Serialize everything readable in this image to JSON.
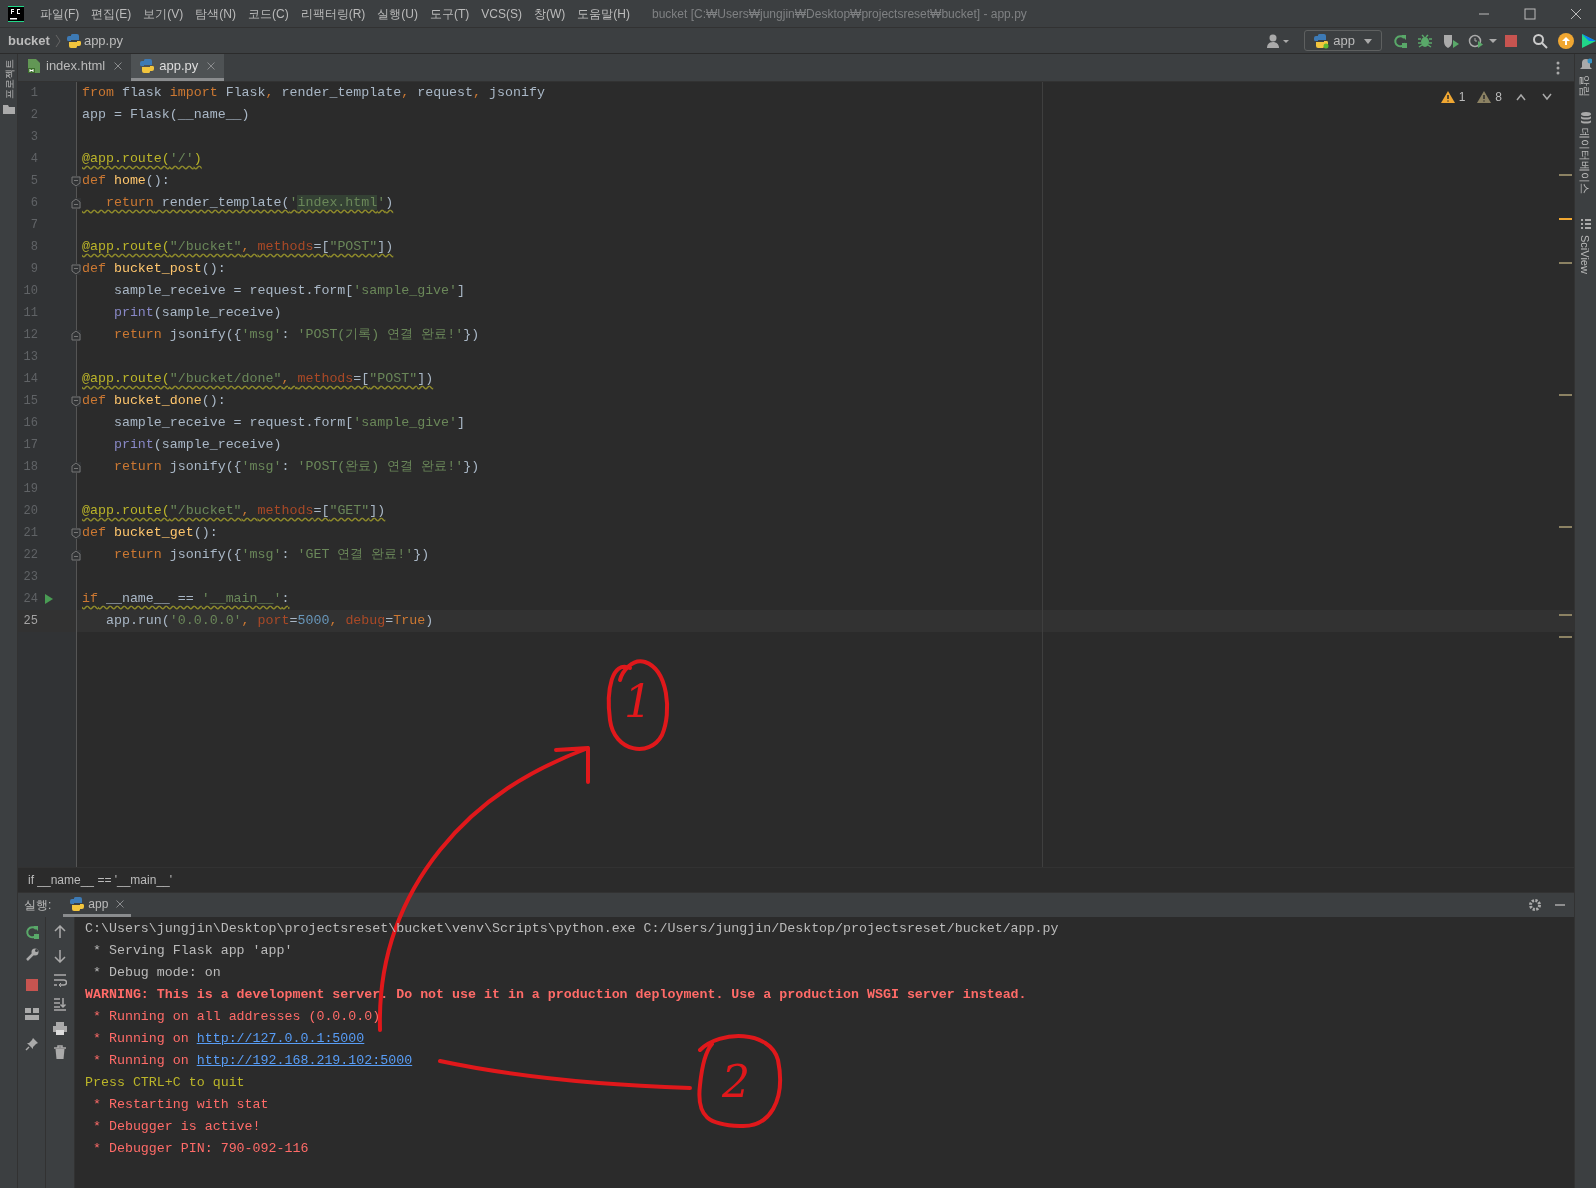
{
  "window": {
    "title": "bucket [C:₩Users₩jungjin₩Desktop₩projectsreset₩bucket] - app.py"
  },
  "menu": [
    "파일(F)",
    "편집(E)",
    "보기(V)",
    "탐색(N)",
    "코드(C)",
    "리팩터링(R)",
    "실행(U)",
    "도구(T)",
    "VCS(S)",
    "창(W)",
    "도움말(H)"
  ],
  "breadcrumbs": [
    "bucket",
    "app.py"
  ],
  "run_config": "app",
  "left_strip": [
    "프로젝트"
  ],
  "right_strip": [
    "알림",
    "데이터베이스",
    "SciView"
  ],
  "tabs": [
    {
      "label": "index.html",
      "kind": "html",
      "selected": false
    },
    {
      "label": "app.py",
      "kind": "python",
      "selected": true
    }
  ],
  "inspections": {
    "warnings": "1",
    "weak_warnings": "8"
  },
  "code_lines": [
    {
      "number": "1",
      "current": false,
      "squiggly": false,
      "tokens": [
        {
          "kind": "kw",
          "t": "from"
        },
        {
          "kind": "tx",
          "t": " flask "
        },
        {
          "kind": "kw",
          "t": "import"
        },
        {
          "kind": "tx",
          "t": " Flask"
        },
        {
          "kind": "kw",
          "t": ", "
        },
        {
          "kind": "tx",
          "t": "render_template"
        },
        {
          "kind": "kw",
          "t": ", "
        },
        {
          "kind": "tx",
          "t": "request"
        },
        {
          "kind": "kw",
          "t": ", "
        },
        {
          "kind": "tx",
          "t": "jsonify"
        }
      ]
    },
    {
      "number": "2",
      "current": false,
      "squiggly": false,
      "tokens": [
        {
          "kind": "tx",
          "t": "app = Flask(__name__)"
        }
      ]
    },
    {
      "number": "3",
      "current": false
    },
    {
      "number": "4",
      "current": false,
      "squiggly": true,
      "tokens": [
        {
          "kind": "dec",
          "t": "@app.route("
        },
        {
          "kind": "str",
          "t": "'/'"
        },
        {
          "kind": "dec",
          "t": ")"
        }
      ]
    },
    {
      "number": "5",
      "current": false,
      "squiggly": false,
      "fold_start": true,
      "tokens": [
        {
          "kind": "kw",
          "t": "def "
        },
        {
          "kind": "fn",
          "t": "home"
        },
        {
          "kind": "tx",
          "t": "():"
        }
      ]
    },
    {
      "number": "6",
      "current": false,
      "squiggly": true,
      "fold_end": true,
      "tokens": [
        {
          "kind": "kw",
          "t": "   return"
        },
        {
          "kind": "tx",
          "t": " render_template("
        },
        {
          "kind": "str",
          "t": "'"
        },
        {
          "kind": "hl",
          "t": "index.html"
        },
        {
          "kind": "str",
          "t": "'"
        },
        {
          "kind": "tx",
          "t": ")"
        }
      ]
    },
    {
      "number": "7",
      "current": false
    },
    {
      "number": "8",
      "current": false,
      "squiggly": true,
      "tokens": [
        {
          "kind": "dec",
          "t": "@app.route("
        },
        {
          "kind": "str",
          "t": "\"/bucket\""
        },
        {
          "kind": "kw",
          "t": ", "
        },
        {
          "kind": "par",
          "t": "methods"
        },
        {
          "kind": "tx",
          "t": "=["
        },
        {
          "kind": "str",
          "t": "\"POST\""
        },
        {
          "kind": "tx",
          "t": "])"
        }
      ]
    },
    {
      "number": "9",
      "current": false,
      "squiggly": false,
      "fold_start": true,
      "tokens": [
        {
          "kind": "kw",
          "t": "def "
        },
        {
          "kind": "fn",
          "t": "bucket_post"
        },
        {
          "kind": "tx",
          "t": "():"
        }
      ]
    },
    {
      "number": "10",
      "current": false,
      "squiggly": false,
      "tokens": [
        {
          "kind": "tx",
          "t": "    sample_receive = request.form["
        },
        {
          "kind": "str",
          "t": "'sample_give'"
        },
        {
          "kind": "tx",
          "t": "]"
        }
      ]
    },
    {
      "number": "11",
      "current": false,
      "squiggly": false,
      "tokens": [
        {
          "kind": "bi",
          "t": "    print"
        },
        {
          "kind": "tx",
          "t": "(sample_receive)"
        }
      ]
    },
    {
      "number": "12",
      "current": false,
      "squiggly": false,
      "fold_end": true,
      "tokens": [
        {
          "kind": "kw",
          "t": "    return"
        },
        {
          "kind": "tx",
          "t": " jsonify({"
        },
        {
          "kind": "str",
          "t": "'msg'"
        },
        {
          "kind": "tx",
          "t": ": "
        },
        {
          "kind": "str",
          "t": "'POST(기록) 연결 완료!'"
        },
        {
          "kind": "tx",
          "t": "})"
        }
      ]
    },
    {
      "number": "13",
      "current": false
    },
    {
      "number": "14",
      "current": false,
      "squiggly": true,
      "tokens": [
        {
          "kind": "dec",
          "t": "@app.route("
        },
        {
          "kind": "str",
          "t": "\"/bucket/done\""
        },
        {
          "kind": "kw",
          "t": ", "
        },
        {
          "kind": "par",
          "t": "methods"
        },
        {
          "kind": "tx",
          "t": "=["
        },
        {
          "kind": "str",
          "t": "\"POST\""
        },
        {
          "kind": "tx",
          "t": "])"
        }
      ]
    },
    {
      "number": "15",
      "current": false,
      "squiggly": false,
      "fold_start": true,
      "tokens": [
        {
          "kind": "kw",
          "t": "def "
        },
        {
          "kind": "fn",
          "t": "bucket_done"
        },
        {
          "kind": "tx",
          "t": "():"
        }
      ]
    },
    {
      "number": "16",
      "current": false,
      "squiggly": false,
      "tokens": [
        {
          "kind": "tx",
          "t": "    sample_receive = request.form["
        },
        {
          "kind": "str",
          "t": "'sample_give'"
        },
        {
          "kind": "tx",
          "t": "]"
        }
      ]
    },
    {
      "number": "17",
      "current": false,
      "squiggly": false,
      "tokens": [
        {
          "kind": "bi",
          "t": "    print"
        },
        {
          "kind": "tx",
          "t": "(sample_receive)"
        }
      ]
    },
    {
      "number": "18",
      "current": false,
      "squiggly": false,
      "fold_end": true,
      "tokens": [
        {
          "kind": "kw",
          "t": "    return"
        },
        {
          "kind": "tx",
          "t": " jsonify({"
        },
        {
          "kind": "str",
          "t": "'msg'"
        },
        {
          "kind": "tx",
          "t": ": "
        },
        {
          "kind": "str",
          "t": "'POST(완료) 연결 완료!'"
        },
        {
          "kind": "tx",
          "t": "})"
        }
      ]
    },
    {
      "number": "19",
      "current": false
    },
    {
      "number": "20",
      "current": false,
      "squiggly": true,
      "tokens": [
        {
          "kind": "dec",
          "t": "@app.route("
        },
        {
          "kind": "str",
          "t": "\"/bucket\""
        },
        {
          "kind": "kw",
          "t": ", "
        },
        {
          "kind": "par",
          "t": "methods"
        },
        {
          "kind": "tx",
          "t": "=["
        },
        {
          "kind": "str",
          "t": "\"GET\""
        },
        {
          "kind": "tx",
          "t": "])"
        }
      ]
    },
    {
      "number": "21",
      "current": false,
      "squiggly": false,
      "fold_start": true,
      "tokens": [
        {
          "kind": "kw",
          "t": "def "
        },
        {
          "kind": "fn",
          "t": "bucket_get"
        },
        {
          "kind": "tx",
          "t": "():"
        }
      ]
    },
    {
      "number": "22",
      "current": false,
      "squiggly": false,
      "fold_end": true,
      "tokens": [
        {
          "kind": "kw",
          "t": "    return"
        },
        {
          "kind": "tx",
          "t": " jsonify({"
        },
        {
          "kind": "str",
          "t": "'msg'"
        },
        {
          "kind": "tx",
          "t": ": "
        },
        {
          "kind": "str",
          "t": "'GET 연결 완료!'"
        },
        {
          "kind": "tx",
          "t": "})"
        }
      ]
    },
    {
      "number": "23",
      "current": false
    },
    {
      "number": "24",
      "current": false,
      "squiggly": true,
      "run": true,
      "tokens": [
        {
          "kind": "kw",
          "t": "if"
        },
        {
          "kind": "tx",
          "t": " __name__ == "
        },
        {
          "kind": "str",
          "t": "'__main__'"
        },
        {
          "kind": "tx",
          "t": ":"
        }
      ]
    },
    {
      "number": "25",
      "current": true,
      "squiggly": false,
      "tokens": [
        {
          "kind": "tx",
          "t": "   app.run("
        },
        {
          "kind": "str",
          "t": "'0.0.0.0'"
        },
        {
          "kind": "kw",
          "t": ", "
        },
        {
          "kind": "par",
          "t": "port"
        },
        {
          "kind": "tx",
          "t": "="
        },
        {
          "kind": "num",
          "t": "5000"
        },
        {
          "kind": "kw",
          "t": ", "
        },
        {
          "kind": "par",
          "t": "debug"
        },
        {
          "kind": "tx",
          "t": "="
        },
        {
          "kind": "kw",
          "t": "True"
        },
        {
          "kind": "tx",
          "t": ")"
        }
      ]
    }
  ],
  "editor_breadcrumb": "if __name__ == '__main__'",
  "run_panel": {
    "label": "실행:",
    "tab": {
      "label": "app",
      "selected": true
    }
  },
  "console_lines": [
    {
      "kind": "plain",
      "text": "C:\\Users\\jungjin\\Desktop\\projectsreset\\bucket\\venv\\Scripts\\python.exe C:/Users/jungjin/Desktop/projectsreset/bucket/app.py"
    },
    {
      "kind": "plain",
      "text": " * Serving Flask app 'app'"
    },
    {
      "kind": "plain",
      "text": " * Debug mode: on"
    },
    {
      "kind": "warning",
      "text": "WARNING: This is a development server. Do not use it in a production deployment. Use a production WSGI server instead."
    },
    {
      "kind": "error",
      "text": " * Running on all addresses (0.0.0.0)"
    },
    {
      "kind": "error",
      "text": " * Running on ",
      "link": "http://127.0.0.1:5000"
    },
    {
      "kind": "error",
      "text": " * Running on ",
      "link": "http://192.168.219.102:5000"
    },
    {
      "kind": "notice",
      "text": "Press CTRL+C to quit"
    },
    {
      "kind": "error",
      "text": " * Restarting with stat"
    },
    {
      "kind": "error",
      "text": " * Debugger is active!"
    },
    {
      "kind": "error",
      "text": " * Debugger PIN: 790-092-116"
    }
  ],
  "annotations": [
    {
      "label": "1"
    },
    {
      "label": "2"
    }
  ]
}
